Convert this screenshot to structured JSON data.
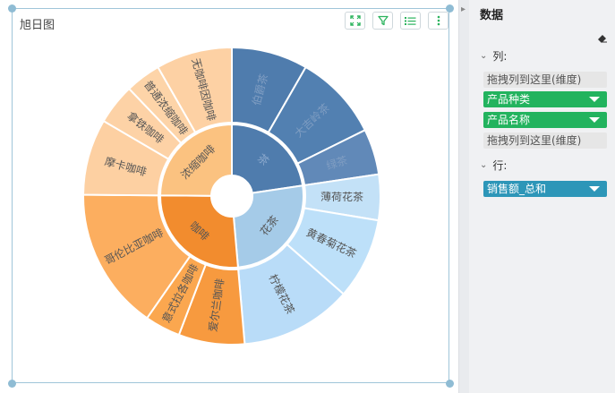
{
  "widget": {
    "title": "旭日图"
  },
  "panel": {
    "title": "数据",
    "columns_label": "列:",
    "rows_label": "行:",
    "column_slots": [
      {
        "label": "拖拽列到这里(维度)",
        "kind": "empty"
      },
      {
        "label": "产品种类",
        "kind": "dim"
      },
      {
        "label": "产品名称",
        "kind": "dim"
      },
      {
        "label": "拖拽列到这里(维度)",
        "kind": "empty"
      }
    ],
    "row_slots": [
      {
        "label": "销售额_总和",
        "kind": "measure"
      }
    ]
  },
  "icons": {
    "fullscreen": "expand-icon",
    "filter": "filter-icon",
    "list": "list-icon",
    "more": "more-vertical-icon",
    "eraser": "eraser-icon",
    "collapse": "chevron-right-icon"
  },
  "chart_data": {
    "type": "sunburst",
    "title": "",
    "categories": [
      {
        "name": "茶",
        "color": "#4f7cad",
        "children": [
          {
            "name": "伯爵茶",
            "value": 7.5,
            "color": "#4f7cad"
          },
          {
            "name": "大吉岭茶",
            "value": 8.5,
            "color": "#5280b1"
          },
          {
            "name": "绿茶",
            "value": 4.5,
            "color": "#6189b8"
          }
        ]
      },
      {
        "name": "花茶",
        "color": "#a5cbe8",
        "children": [
          {
            "name": "薄荷花茶",
            "value": 4.5,
            "color": "#c3e1f7"
          },
          {
            "name": "黄春菊花茶",
            "value": 8,
            "color": "#bde0f9"
          },
          {
            "name": "柠檬花茶",
            "value": 11,
            "color": "#b9dcf8"
          }
        ]
      },
      {
        "name": "咖啡",
        "color": "#f28c2e",
        "children": [
          {
            "name": "爱尔兰咖啡",
            "value": 6.5,
            "color": "#f79a3f"
          },
          {
            "name": "意式拉各咖啡",
            "value": 3.5,
            "color": "#fba74f"
          },
          {
            "name": "哥伦比亚咖啡",
            "value": 14,
            "color": "#fcae5f"
          }
        ]
      },
      {
        "name": "浓缩咖啡",
        "color": "#fbc280",
        "children": [
          {
            "name": "摩卡咖啡",
            "value": 7.5,
            "color": "#fdd0a2"
          },
          {
            "name": "拿铁咖啡",
            "value": 4,
            "color": "#fdd2a6"
          },
          {
            "name": "普通浓缩咖啡",
            "value": 3.5,
            "color": "#fdd4a8"
          },
          {
            "name": "无咖啡因咖啡",
            "value": 7.5,
            "color": "#fdd1a4"
          }
        ]
      }
    ]
  }
}
